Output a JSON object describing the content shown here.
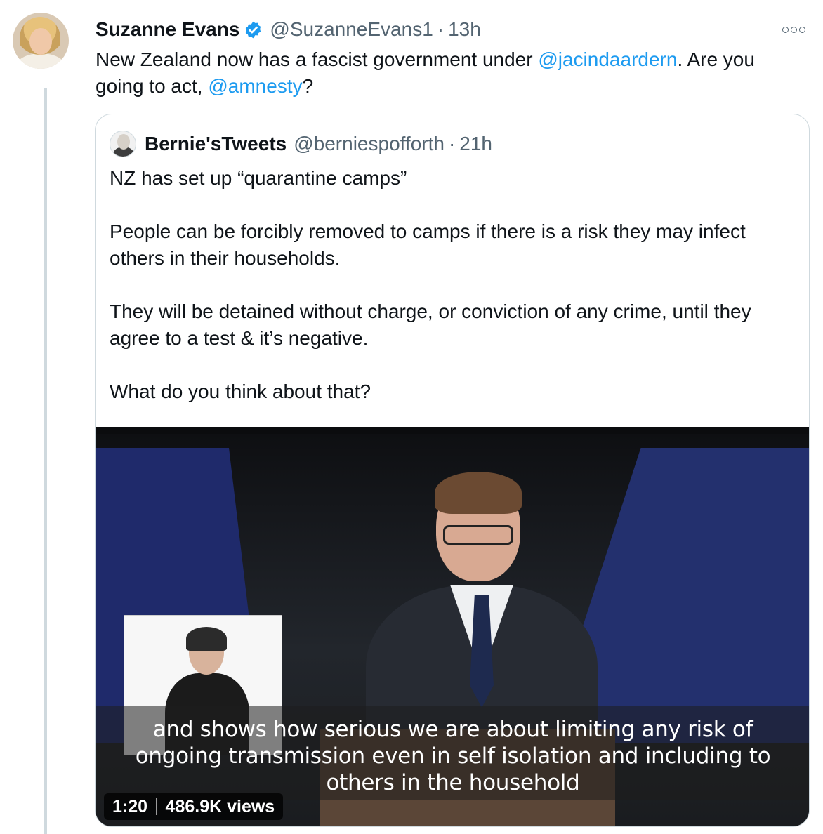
{
  "tweet": {
    "author": {
      "display_name": "Suzanne Evans",
      "handle": "@SuzanneEvans1",
      "verified": true
    },
    "time": "13h",
    "separator": "·",
    "text_before": "New Zealand now has a fascist government under ",
    "mention_1": "@jacindaardern",
    "text_middle": ". Are you going to act, ",
    "mention_2": "@amnesty",
    "text_after": "?"
  },
  "quoted_tweet": {
    "author": {
      "display_name": "Bernie'sTweets",
      "handle": "@berniespofforth"
    },
    "separator": "·",
    "time": "21h",
    "paragraphs": [
      "NZ has set up “quarantine camps”",
      "People can be forcibly removed to camps if there is a risk they may infect others in their households.",
      "They will be detained without charge, or conviction of any crime, until they agree to a test & it’s negative.",
      "What do you think about that?"
    ],
    "video": {
      "caption_lines": [
        "and shows how serious we are about limiting any risk of",
        "ongoing transmission even in self isolation and including to",
        "others in the household"
      ],
      "duration": "1:20",
      "views": "486.9K views"
    }
  },
  "colors": {
    "link": "#1d9bf0",
    "secondary_text": "#536471",
    "verified_badge": "#1d9bf0",
    "border": "#cfd9de"
  },
  "icons": {
    "verified": "verified-badge-icon",
    "more": "more-options-icon"
  }
}
